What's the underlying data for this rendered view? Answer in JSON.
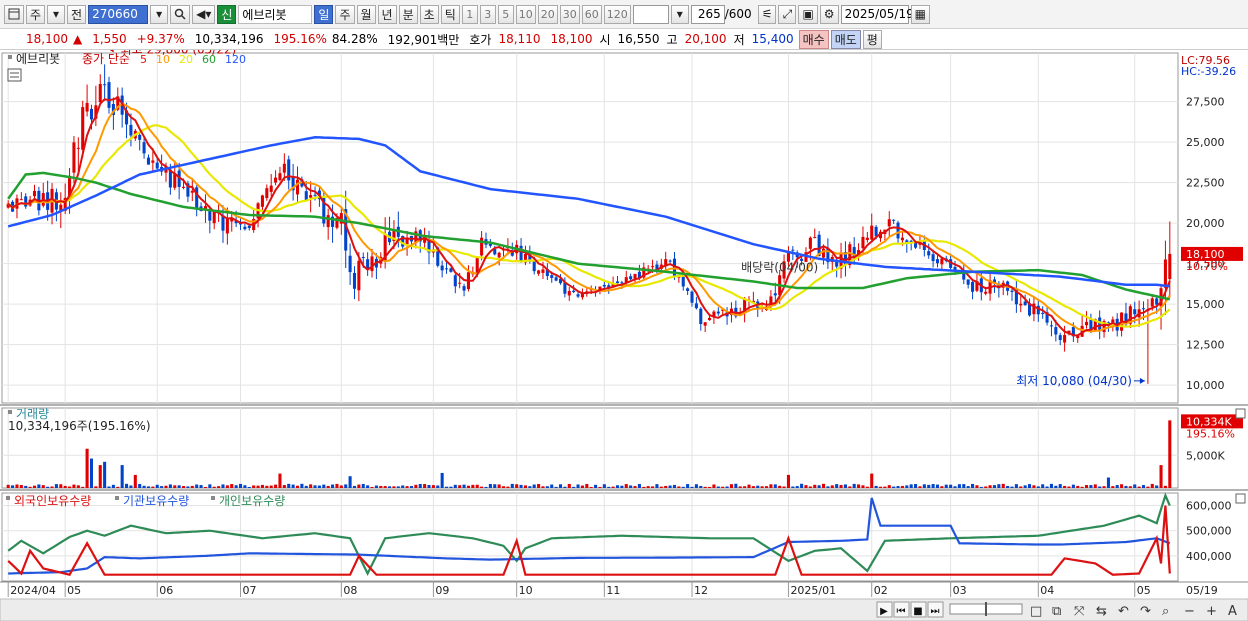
{
  "toolbar": {
    "mode1": "주",
    "mode2": "전",
    "code": "270660",
    "badge": "신",
    "name": "에브리봇",
    "periods": [
      "일",
      "주",
      "월",
      "년",
      "분",
      "초",
      "틱"
    ],
    "period_selected": "일",
    "ticks": [
      "1",
      "3",
      "5",
      "10",
      "20",
      "30",
      "60",
      "120"
    ],
    "count": "265",
    "count_total": "/600",
    "date": "2025/05/19"
  },
  "quote": {
    "price": "18,100",
    "change": "1,550",
    "change_pct": "+9.37%",
    "volume": "10,334,196",
    "volume_ratio": "195.16%",
    "turnover": "84.28%",
    "amount": "192,901백만",
    "ask_label": "호가",
    "ask": "18,110",
    "bid": "18,100",
    "open_label": "시",
    "open": "16,550",
    "high_label": "고",
    "high": "20,100",
    "low_label": "저",
    "low": "15,400",
    "buy": "매수",
    "sell": "매도",
    "eval": "평"
  },
  "price_panel": {
    "title": "에브리봇",
    "ma_label": "종가 단순",
    "ma_periods": [
      {
        "p": "5",
        "color": "#dd1111"
      },
      {
        "p": "10",
        "color": "#ff9900"
      },
      {
        "p": "20",
        "color": "#e8e800"
      },
      {
        "p": "60",
        "color": "#22a030"
      },
      {
        "p": "120",
        "color": "#2255ff"
      }
    ],
    "lc": "LC:79.56",
    "hc": "HC:-39.26",
    "max_label": "최고 29,800 (05/22)",
    "min_label": "최저 10,080 (04/30)",
    "dividend_label": "배당락(04/00)",
    "last_price": "18,100",
    "last_pct": "10.70%"
  },
  "volume_panel": {
    "title": "거래량",
    "value_text": "10,334,196주(195.16%)",
    "last_tag": "10,334K",
    "last_pct": "195.16%"
  },
  "holding_panel": {
    "legend": [
      {
        "label": "외국인보유수량",
        "color": "#dd1111"
      },
      {
        "label": "기관보유수량",
        "color": "#2255dd"
      },
      {
        "label": "개인보유수량",
        "color": "#2e8b57"
      }
    ]
  },
  "chart_data": {
    "type": "candlestick",
    "price_axis": {
      "ticks": [
        10000,
        12500,
        15000,
        17500,
        20000,
        22500,
        25000,
        27500
      ],
      "labels": [
        "10,000",
        "12,500",
        "15,000",
        "17,500",
        "20,000",
        "22,500",
        "25,000",
        "27,500"
      ],
      "range": [
        8900,
        30500
      ]
    },
    "volume_axis": {
      "ticks": [
        5000
      ],
      "labels": [
        "5,000K"
      ]
    },
    "holding_axis": {
      "ticks": [
        400000,
        500000,
        600000
      ],
      "labels": [
        "400,000",
        "500,000",
        "600,000"
      ]
    },
    "x_labels": [
      {
        "i": 0,
        "label": "2024/04"
      },
      {
        "i": 13,
        "label": "05"
      },
      {
        "i": 34,
        "label": "06"
      },
      {
        "i": 53,
        "label": "07"
      },
      {
        "i": 76,
        "label": "08"
      },
      {
        "i": 97,
        "label": "09"
      },
      {
        "i": 116,
        "label": "10"
      },
      {
        "i": 136,
        "label": "11"
      },
      {
        "i": 156,
        "label": "12"
      },
      {
        "i": 178,
        "label": "2025/01"
      },
      {
        "i": 197,
        "label": "02"
      },
      {
        "i": 215,
        "label": "03"
      },
      {
        "i": 235,
        "label": "04"
      },
      {
        "i": 257,
        "label": "05"
      }
    ],
    "x_axis_end_label": "05/19",
    "price_series": [
      [
        0,
        21000
      ],
      [
        12,
        21800
      ],
      [
        18,
        26800
      ],
      [
        22,
        28500
      ],
      [
        30,
        25000
      ],
      [
        36,
        22800
      ],
      [
        46,
        20500
      ],
      [
        54,
        19500
      ],
      [
        62,
        23500
      ],
      [
        70,
        21000
      ],
      [
        76,
        19800
      ],
      [
        78,
        16500
      ],
      [
        82,
        17200
      ],
      [
        88,
        19500
      ],
      [
        96,
        18500
      ],
      [
        103,
        15800
      ],
      [
        108,
        18600
      ],
      [
        116,
        18400
      ],
      [
        128,
        15500
      ],
      [
        140,
        16200
      ],
      [
        150,
        17800
      ],
      [
        158,
        14000
      ],
      [
        166,
        14600
      ],
      [
        174,
        15500
      ],
      [
        178,
        17700
      ],
      [
        184,
        18800
      ],
      [
        190,
        17500
      ],
      [
        196,
        19200
      ],
      [
        200,
        20200
      ],
      [
        206,
        18900
      ],
      [
        214,
        17500
      ],
      [
        220,
        16200
      ],
      [
        228,
        15800
      ],
      [
        234,
        14500
      ],
      [
        240,
        12800
      ],
      [
        246,
        14000
      ],
      [
        252,
        13800
      ],
      [
        258,
        14600
      ],
      [
        262,
        15000
      ],
      [
        265,
        18100
      ]
    ],
    "volatility": [
      [
        0,
        800
      ],
      [
        16,
        2500
      ],
      [
        30,
        1500
      ],
      [
        60,
        1200
      ],
      [
        78,
        2000
      ],
      [
        100,
        1200
      ],
      [
        130,
        700
      ],
      [
        160,
        800
      ],
      [
        178,
        1200
      ],
      [
        197,
        1300
      ],
      [
        214,
        800
      ],
      [
        238,
        1200
      ],
      [
        262,
        1100
      ],
      [
        265,
        5000
      ]
    ],
    "extremes": {
      "max": {
        "i": 22,
        "value": 29800,
        "date": "05/22"
      },
      "min": {
        "i": 260,
        "value": 10080,
        "date": "04/30"
      },
      "last": {
        "open": 16550,
        "high": 20100,
        "low": 15400,
        "close": 18100
      }
    },
    "dividend_index": 176,
    "ma120_points": [
      [
        0,
        19800
      ],
      [
        10,
        20500
      ],
      [
        20,
        21700
      ],
      [
        30,
        23000
      ],
      [
        45,
        23900
      ],
      [
        60,
        24800
      ],
      [
        70,
        25300
      ],
      [
        80,
        25200
      ],
      [
        86,
        24800
      ],
      [
        94,
        23200
      ],
      [
        110,
        22100
      ],
      [
        130,
        21500
      ],
      [
        150,
        20400
      ],
      [
        170,
        18700
      ],
      [
        185,
        17800
      ],
      [
        200,
        17300
      ],
      [
        220,
        17000
      ],
      [
        240,
        16700
      ],
      [
        255,
        16200
      ],
      [
        262,
        16200
      ],
      [
        265,
        16100
      ]
    ],
    "ma60_points": [
      [
        0,
        21500
      ],
      [
        4,
        23000
      ],
      [
        8,
        23100
      ],
      [
        15,
        22800
      ],
      [
        20,
        22500
      ],
      [
        28,
        21800
      ],
      [
        40,
        21000
      ],
      [
        55,
        20500
      ],
      [
        70,
        20400
      ],
      [
        80,
        20000
      ],
      [
        95,
        19200
      ],
      [
        110,
        18800
      ],
      [
        130,
        17500
      ],
      [
        150,
        17000
      ],
      [
        170,
        16400
      ],
      [
        180,
        16000
      ],
      [
        195,
        16000
      ],
      [
        205,
        16600
      ],
      [
        220,
        17000
      ],
      [
        235,
        17100
      ],
      [
        245,
        16800
      ],
      [
        255,
        15900
      ],
      [
        265,
        15300
      ]
    ],
    "volume_hi": [
      {
        "i": 18,
        "v": 6000
      },
      {
        "i": 19,
        "v": 4500
      },
      {
        "i": 21,
        "v": 3500
      },
      {
        "i": 22,
        "v": 4000
      },
      {
        "i": 26,
        "v": 3500
      },
      {
        "i": 29,
        "v": 2000
      },
      {
        "i": 62,
        "v": 2200
      },
      {
        "i": 78,
        "v": 1800
      },
      {
        "i": 99,
        "v": 2300
      },
      {
        "i": 178,
        "v": 2000
      },
      {
        "i": 197,
        "v": 2200
      },
      {
        "i": 251,
        "v": 1600
      },
      {
        "i": 263,
        "v": 3500
      },
      {
        "i": 265,
        "v": 10334
      }
    ],
    "holding_series": {
      "foreign": [
        [
          0,
          380000
        ],
        [
          3,
          330000
        ],
        [
          5,
          420000
        ],
        [
          8,
          350000
        ],
        [
          14,
          325000
        ],
        [
          18,
          450000
        ],
        [
          22,
          325000
        ],
        [
          78,
          325000
        ],
        [
          80,
          400000
        ],
        [
          84,
          325000
        ],
        [
          113,
          325000
        ],
        [
          116,
          460000
        ],
        [
          118,
          325000
        ],
        [
          175,
          325000
        ],
        [
          178,
          470000
        ],
        [
          181,
          325000
        ],
        [
          238,
          325000
        ],
        [
          241,
          390000
        ],
        [
          248,
          370000
        ],
        [
          252,
          325000
        ],
        [
          258,
          330000
        ],
        [
          262,
          470000
        ],
        [
          263,
          370000
        ],
        [
          264,
          600000
        ],
        [
          265,
          330000
        ]
      ],
      "institution": [
        [
          0,
          330000
        ],
        [
          12,
          335000
        ],
        [
          18,
          350000
        ],
        [
          22,
          395000
        ],
        [
          30,
          390000
        ],
        [
          45,
          400000
        ],
        [
          55,
          410000
        ],
        [
          80,
          405000
        ],
        [
          100,
          390000
        ],
        [
          110,
          385000
        ],
        [
          130,
          392000
        ],
        [
          150,
          393000
        ],
        [
          170,
          395000
        ],
        [
          178,
          455000
        ],
        [
          190,
          460000
        ],
        [
          196,
          465000
        ],
        [
          197,
          630000
        ],
        [
          199,
          520000
        ],
        [
          215,
          520000
        ],
        [
          217,
          450000
        ],
        [
          235,
          445000
        ],
        [
          240,
          445000
        ],
        [
          255,
          455000
        ],
        [
          262,
          470000
        ],
        [
          265,
          450000
        ]
      ],
      "individual": [
        [
          0,
          420000
        ],
        [
          3,
          460000
        ],
        [
          8,
          410000
        ],
        [
          14,
          475000
        ],
        [
          18,
          500000
        ],
        [
          22,
          480000
        ],
        [
          28,
          520000
        ],
        [
          36,
          490000
        ],
        [
          46,
          500000
        ],
        [
          58,
          470000
        ],
        [
          70,
          490000
        ],
        [
          78,
          470000
        ],
        [
          82,
          330000
        ],
        [
          86,
          470000
        ],
        [
          96,
          490000
        ],
        [
          106,
          470000
        ],
        [
          113,
          440000
        ],
        [
          116,
          380000
        ],
        [
          118,
          430000
        ],
        [
          124,
          470000
        ],
        [
          140,
          480000
        ],
        [
          160,
          470000
        ],
        [
          170,
          470000
        ],
        [
          178,
          380000
        ],
        [
          184,
          420000
        ],
        [
          190,
          430000
        ],
        [
          196,
          340000
        ],
        [
          200,
          460000
        ],
        [
          215,
          470000
        ],
        [
          235,
          480000
        ],
        [
          250,
          520000
        ],
        [
          258,
          560000
        ],
        [
          262,
          530000
        ],
        [
          264,
          640000
        ],
        [
          265,
          600000
        ]
      ]
    }
  }
}
